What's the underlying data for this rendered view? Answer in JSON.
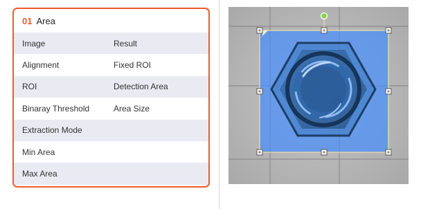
{
  "panel": {
    "number": "01",
    "title": "Area",
    "rows": [
      {
        "label": "Image",
        "value": "Result"
      },
      {
        "label": "Alignment",
        "value": "Fixed ROI"
      },
      {
        "label": "ROI",
        "value": "Detection Area"
      },
      {
        "label": "Binaray Threshold",
        "value": "Area Size"
      },
      {
        "label": "Extraction Mode",
        "value": ""
      },
      {
        "label": "Min Area",
        "value": ""
      },
      {
        "label": "Max Area",
        "value": ""
      }
    ]
  },
  "colors": {
    "accent": "#f05a28",
    "row_shade": "#e9eaf2",
    "roi_fill": "#3f8cff",
    "rotate_handle": "#8bd448"
  },
  "image_view": {
    "subject": "hex-nut-photo",
    "icons": [
      "rotate-handle-icon",
      "resize-handle-icon"
    ]
  }
}
